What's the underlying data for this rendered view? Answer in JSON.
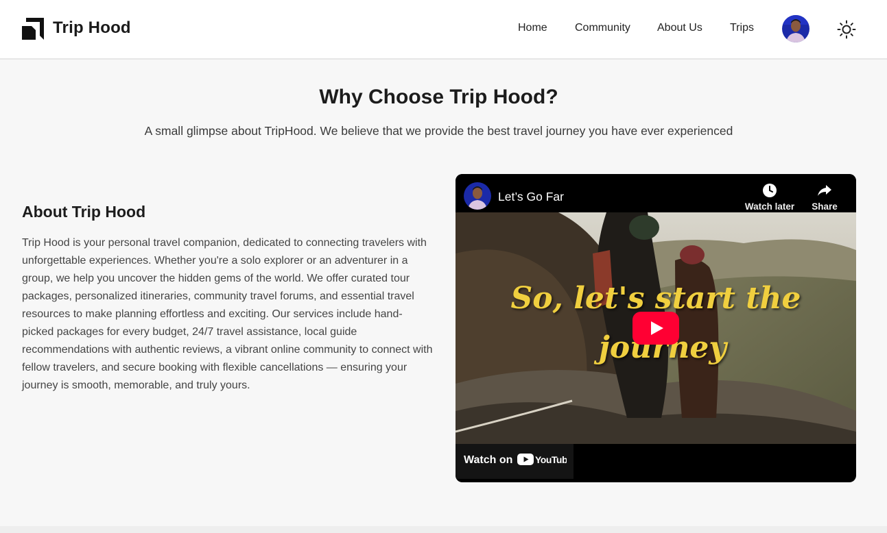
{
  "header": {
    "brand": "Trip Hood",
    "nav": [
      "Home",
      "Community",
      "About Us",
      "Trips"
    ]
  },
  "intro": {
    "title": "Why Choose Trip Hood?",
    "subtitle": "A small glimpse about TripHood. We believe that we provide the best travel journey you have ever experienced"
  },
  "about": {
    "heading": "About Trip Hood",
    "body": "Trip Hood is your personal travel companion, dedicated to connecting travelers with unforgettable experiences. Whether you're a solo explorer or an adventurer in a group, we help you uncover the hidden gems of the world. We offer curated tour packages, personalized itineraries, community travel forums, and essential travel resources to make planning effortless and exciting. Our services include hand-picked packages for every budget, 24/7 travel assistance, local guide recommendations with authentic reviews, a vibrant online community to connect with fellow travelers, and secure booking with flexible cancellations — ensuring your journey is smooth, memorable, and truly yours."
  },
  "video": {
    "title": "Let’s Go Far",
    "watch_later": "Watch later",
    "share": "Share",
    "overlay_line1": "So, let's start the",
    "overlay_line2": "journey",
    "watch_on": "Watch on",
    "youtube": "YouTube"
  },
  "icons": {
    "logo": "trip-hood-logo-icon",
    "theme": "sun-icon",
    "watch_later": "clock-icon",
    "share": "share-arrow-icon",
    "play": "play-icon"
  },
  "colors": {
    "youtube_red": "#ff0033",
    "overlay_text": "#f0cf3f",
    "background": "#f7f7f7"
  }
}
